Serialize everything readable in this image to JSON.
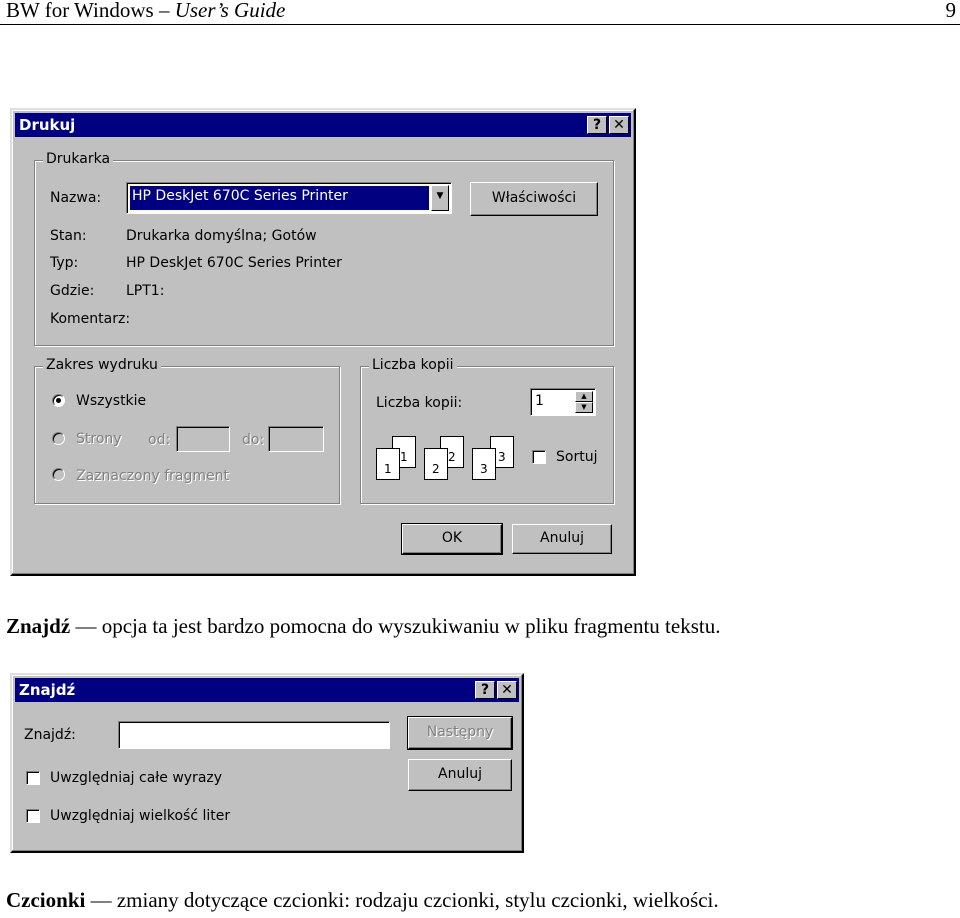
{
  "page_header": {
    "title_plain": "BW for Windows",
    "title_dash": "–",
    "title_italic": "User’s Guide",
    "page_number": "9"
  },
  "print_dialog": {
    "title": "Drukuj",
    "help_button": "?",
    "close_button": "✕",
    "printer_group": "Drukarka",
    "name_label": "Nazwa:",
    "name_value": "HP DeskJet 670C Series Printer",
    "properties_button": "Właściwości",
    "status_label": "Stan:",
    "status_value": "Drukarka domyślna; Gotów",
    "type_label": "Typ:",
    "type_value": "HP DeskJet 670C Series Printer",
    "where_label": "Gdzie:",
    "where_value": "LPT1:",
    "comment_label": "Komentarz:",
    "range_group": "Zakres wydruku",
    "all_option": "Wszystkie",
    "pages_option": "Strony",
    "from_label": "od:",
    "to_label": "do:",
    "selection_option": "Zaznaczony fragment",
    "copies_group": "Liczba kopii",
    "copies_label": "Liczba kopii:",
    "copies_value": "1",
    "collate_label": "Sortuj",
    "collate_pages": [
      "1",
      "1",
      "2",
      "2",
      "3",
      "3"
    ],
    "ok_button": "OK",
    "cancel_button": "Anuluj"
  },
  "paragraph_find": {
    "term": "Znajdź",
    "dash": "—",
    "text": "opcja ta jest bardzo pomocna do wyszukiwaniu w pliku fragmentu tekstu."
  },
  "find_dialog": {
    "title": "Znajdź",
    "help_button": "?",
    "close_button": "✕",
    "find_label": "Znajdź:",
    "find_value": "",
    "next_button": "Następny",
    "cancel_button": "Anuluj",
    "whole_words": "Uwzględniaj całe wyrazy",
    "match_case": "Uwzględniaj wielkość liter"
  },
  "paragraph_fonts": {
    "term": "Czcionki",
    "dash": "—",
    "text": "zmiany dotyczące czcionki: rodzaju czcionki, stylu czcionki, wielkości."
  }
}
